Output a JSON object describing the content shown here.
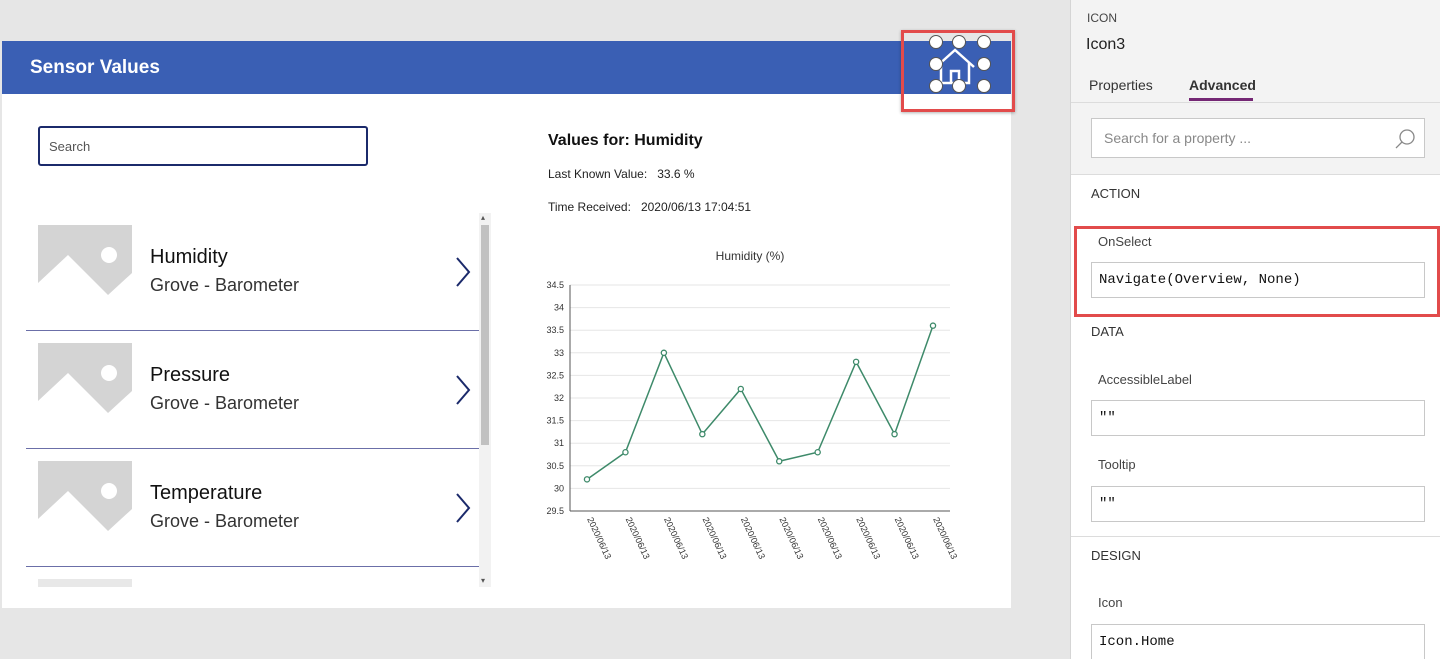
{
  "app": {
    "title": "Sensor Values",
    "search_placeholder": "Search",
    "sensors": [
      {
        "name": "Humidity",
        "subtitle": "Grove - Barometer"
      },
      {
        "name": "Pressure",
        "subtitle": "Grove - Barometer"
      },
      {
        "name": "Temperature",
        "subtitle": "Grove - Barometer"
      }
    ],
    "detail": {
      "title": "Values for: Humidity",
      "last_known_label": "Last Known Value:",
      "last_known_value": "33.6 %",
      "time_label": "Time Received:",
      "time_value": "2020/06/13 17:04:51"
    }
  },
  "chart_data": {
    "type": "line",
    "title": "Humidity  (%)",
    "x": [
      "2020/06/13",
      "2020/06/13",
      "2020/06/13",
      "2020/06/13",
      "2020/06/13",
      "2020/06/13",
      "2020/06/13",
      "2020/06/13",
      "2020/06/13",
      "2020/06/13"
    ],
    "series": [
      {
        "values": [
          30.2,
          30.8,
          33.0,
          31.2,
          32.2,
          30.6,
          30.8,
          32.8,
          31.2,
          33.6
        ]
      }
    ],
    "y_ticks": [
      "29.5",
      "30",
      "30.5",
      "31",
      "31.5",
      "32",
      "32.5",
      "33",
      "33.5",
      "34",
      "34.5"
    ],
    "ylim": [
      29.5,
      34.5
    ],
    "line_color": "#3e8a6a",
    "grid": true
  },
  "panel": {
    "control_type": "ICON",
    "control_name": "Icon3",
    "tabs": [
      "Properties",
      "Advanced"
    ],
    "active_tab": "Advanced",
    "search_placeholder": "Search for a property ...",
    "sections": {
      "action": "ACTION",
      "data": "DATA",
      "design": "DESIGN"
    },
    "props": {
      "onselect_label": "OnSelect",
      "onselect_value": "Navigate(Overview, None)",
      "accessible_label": "AccessibleLabel",
      "accessible_value": "\"\"",
      "tooltip_label": "Tooltip",
      "tooltip_value": "\"\"",
      "icon_label": "Icon",
      "icon_value": "Icon.Home"
    }
  },
  "colors": {
    "header": "#3a5fb4",
    "highlight": "#e24b4b",
    "tab_accent": "#742774"
  }
}
